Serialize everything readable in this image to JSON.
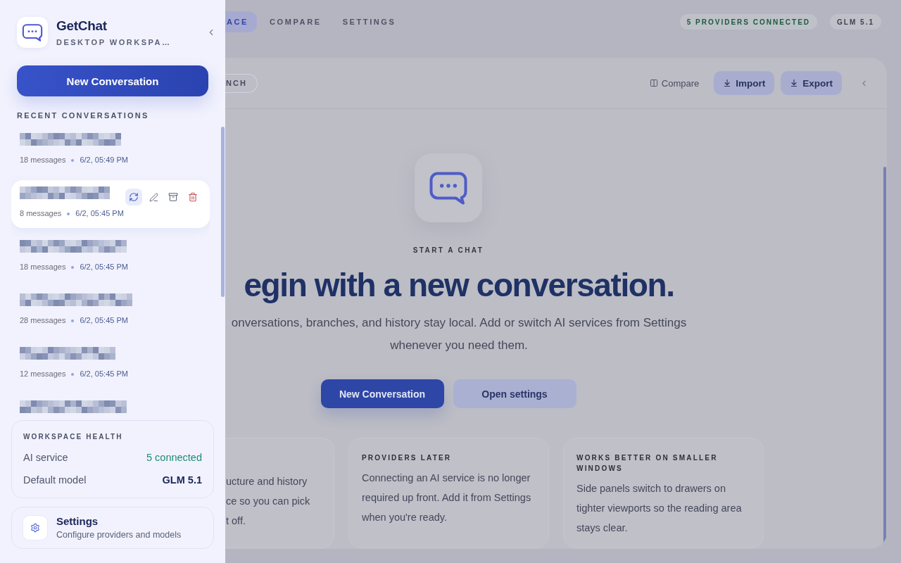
{
  "sidebar": {
    "app": {
      "name": "GetChat",
      "subtitle": "DESKTOP WORKSPA…"
    },
    "new_button": "New Conversation",
    "section_title": "RECENT CONVERSATIONS",
    "conversations": [
      {
        "messages": "18 messages",
        "date": "6/2, 05:49 PM",
        "selected": false
      },
      {
        "messages": "8 messages",
        "date": "6/2, 05:45 PM",
        "selected": true
      },
      {
        "messages": "18 messages",
        "date": "6/2, 05:45 PM",
        "selected": false
      },
      {
        "messages": "28 messages",
        "date": "6/2, 05:45 PM",
        "selected": false
      },
      {
        "messages": "12 messages",
        "date": "6/2, 05:45 PM",
        "selected": false
      },
      {
        "selected": false
      }
    ],
    "health": {
      "title": "WORKSPACE HEALTH",
      "rows": [
        {
          "label": "AI service",
          "value": "5 connected",
          "kind": "status"
        },
        {
          "label": "Default model",
          "value": "GLM 5.1",
          "kind": "model"
        }
      ]
    },
    "settings": {
      "title": "Settings",
      "subtitle": "Configure providers and models"
    }
  },
  "main": {
    "nav_tabs": [
      {
        "label": "ACE",
        "selected": true
      },
      {
        "label": "COMPARE",
        "selected": false
      },
      {
        "label": "SETTINGS",
        "selected": false
      }
    ],
    "status_chips": [
      {
        "label": "5 PROVIDERS CONNECTED",
        "kind": "status"
      },
      {
        "label": "GLM 5.1",
        "kind": "model"
      }
    ],
    "toolbar": {
      "branch_chip": "NCH",
      "compare": "Compare",
      "buttons": [
        "Import",
        "Export"
      ]
    },
    "hero": {
      "eyebrow": "START A CHAT",
      "heading": "egin with a new conversation.",
      "text": "onversations, branches, and history stay local. Add or switch AI services from Settings whenever you need them.",
      "buttons": [
        {
          "label": "New Conversation",
          "kind": "primary"
        },
        {
          "label": "Open settings",
          "kind": "secondary"
        }
      ]
    },
    "cards": [
      {
        "lines": [
          "ucture and history",
          "ce so you can pick",
          "t off."
        ]
      },
      {
        "title": "PROVIDERS LATER",
        "body": "Connecting an AI service is no longer required up front. Add it from Settings when you're ready."
      },
      {
        "title": "WORKS BETTER ON SMALLER WINDOWS",
        "body": "Side panels switch to drawers on tighter viewports so the reading area stays clear."
      }
    ]
  }
}
